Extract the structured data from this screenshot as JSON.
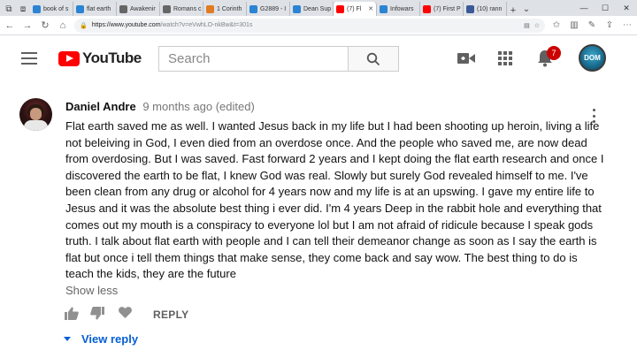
{
  "browser": {
    "tabs": [
      {
        "label": "book of s",
        "color": "#2b83d3"
      },
      {
        "label": "flat earth",
        "color": "#2b83d3"
      },
      {
        "label": "Awakenir",
        "color": "#666666"
      },
      {
        "label": "Romans c",
        "color": "#666666"
      },
      {
        "label": "1 Corinth",
        "color": "#e07b22"
      },
      {
        "label": "G2889 - I",
        "color": "#2b83d3"
      },
      {
        "label": "Dean Sup",
        "color": "#2b83d3"
      },
      {
        "label": "(7) Fl",
        "color": "#ff0000"
      },
      {
        "label": "Infowars",
        "color": "#2b83d3"
      },
      {
        "label": "(7) First P",
        "color": "#ff0000"
      },
      {
        "label": "(10) rann",
        "color": "#3b5998"
      }
    ],
    "active_tab_index": 7,
    "address": {
      "host": "https://www.youtube.com",
      "path": "/watch?v=eVwhLO-nkBw&t=301s"
    }
  },
  "header": {
    "logo_text": "YouTube",
    "search_placeholder": "Search",
    "notification_count": "7",
    "avatar_text": "DOM"
  },
  "comment": {
    "author": "Daniel Andre",
    "time": "9 months ago (edited)",
    "text": "Flat earth saved me as well. I wanted Jesus back in my life but I had been shooting up heroin, living a life not beleiving in God, I even died from an overdose once. And the people who saved me, are now dead from overdosing. But I was saved. Fast forward 2 years and I kept doing the flat earth research and once I discovered the earth to be flat, I knew God was real. Slowly but surely God revealed himself to me. I've been clean from any drug or alcohol for 4 years now and my life is at an upswing. I gave my entire life to Jesus and it was the absolute best thing i ever did. I'm 4 years Deep in the rabbit hole and everything that comes out my mouth is a conspiracy to everyone lol but I am not afraid of ridicule because I speak gods truth. I talk about flat earth with people and I can tell their demeanor change as soon as I say the earth is flat but once i tell them things that make sense, they come back and say wow. The best thing to do is teach the kids, they are the future",
    "show_less": "Show less",
    "reply": "REPLY",
    "view_reply": "View reply"
  },
  "colors": {
    "brand_red": "#ff0000",
    "link_blue": "#065fd4",
    "badge_red": "#cc0000"
  }
}
